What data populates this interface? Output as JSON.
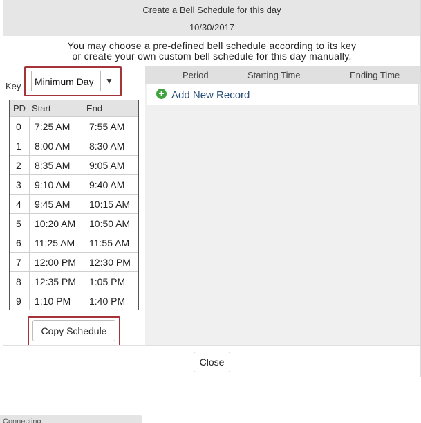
{
  "dialog": {
    "title": "Create a Bell Schedule for this day",
    "date": "10/30/2017",
    "instructions_line1": "You may choose a pre-defined bell schedule according to its key",
    "instructions_line2": "or create your own custom bell schedule for this day manually."
  },
  "key": {
    "label": "Key",
    "selected": "Minimum Day",
    "arrow_icon": "triangle-down-icon"
  },
  "bell_table": {
    "headers": {
      "pd": "PD",
      "start": "Start",
      "end": "End"
    },
    "rows": [
      {
        "pd": "0",
        "start": "7:25 AM",
        "end": "7:55 AM"
      },
      {
        "pd": "1",
        "start": "8:00 AM",
        "end": "8:30 AM"
      },
      {
        "pd": "2",
        "start": "8:35 AM",
        "end": "9:05 AM"
      },
      {
        "pd": "3",
        "start": "9:10 AM",
        "end": "9:40 AM"
      },
      {
        "pd": "4",
        "start": "9:45 AM",
        "end": "10:15 AM"
      },
      {
        "pd": "5",
        "start": "10:20 AM",
        "end": "10:50 AM"
      },
      {
        "pd": "6",
        "start": "11:25 AM",
        "end": "11:55 AM"
      },
      {
        "pd": "7",
        "start": "12:00 PM",
        "end": "12:30 PM"
      },
      {
        "pd": "8",
        "start": "12:35 PM",
        "end": "1:05 PM"
      },
      {
        "pd": "9",
        "start": "1:10 PM",
        "end": "1:40 PM"
      }
    ]
  },
  "copy_button": "Copy Schedule",
  "records": {
    "headers": {
      "period": "Period",
      "start": "Starting Time",
      "end": "Ending Time"
    },
    "add_label": "Add New Record",
    "add_icon": "plus-circle-icon"
  },
  "close_button": "Close",
  "status": "Connecting",
  "colors": {
    "highlight": "#a4343a",
    "add_icon": "#3fa33f",
    "link": "#2a4f7a"
  }
}
